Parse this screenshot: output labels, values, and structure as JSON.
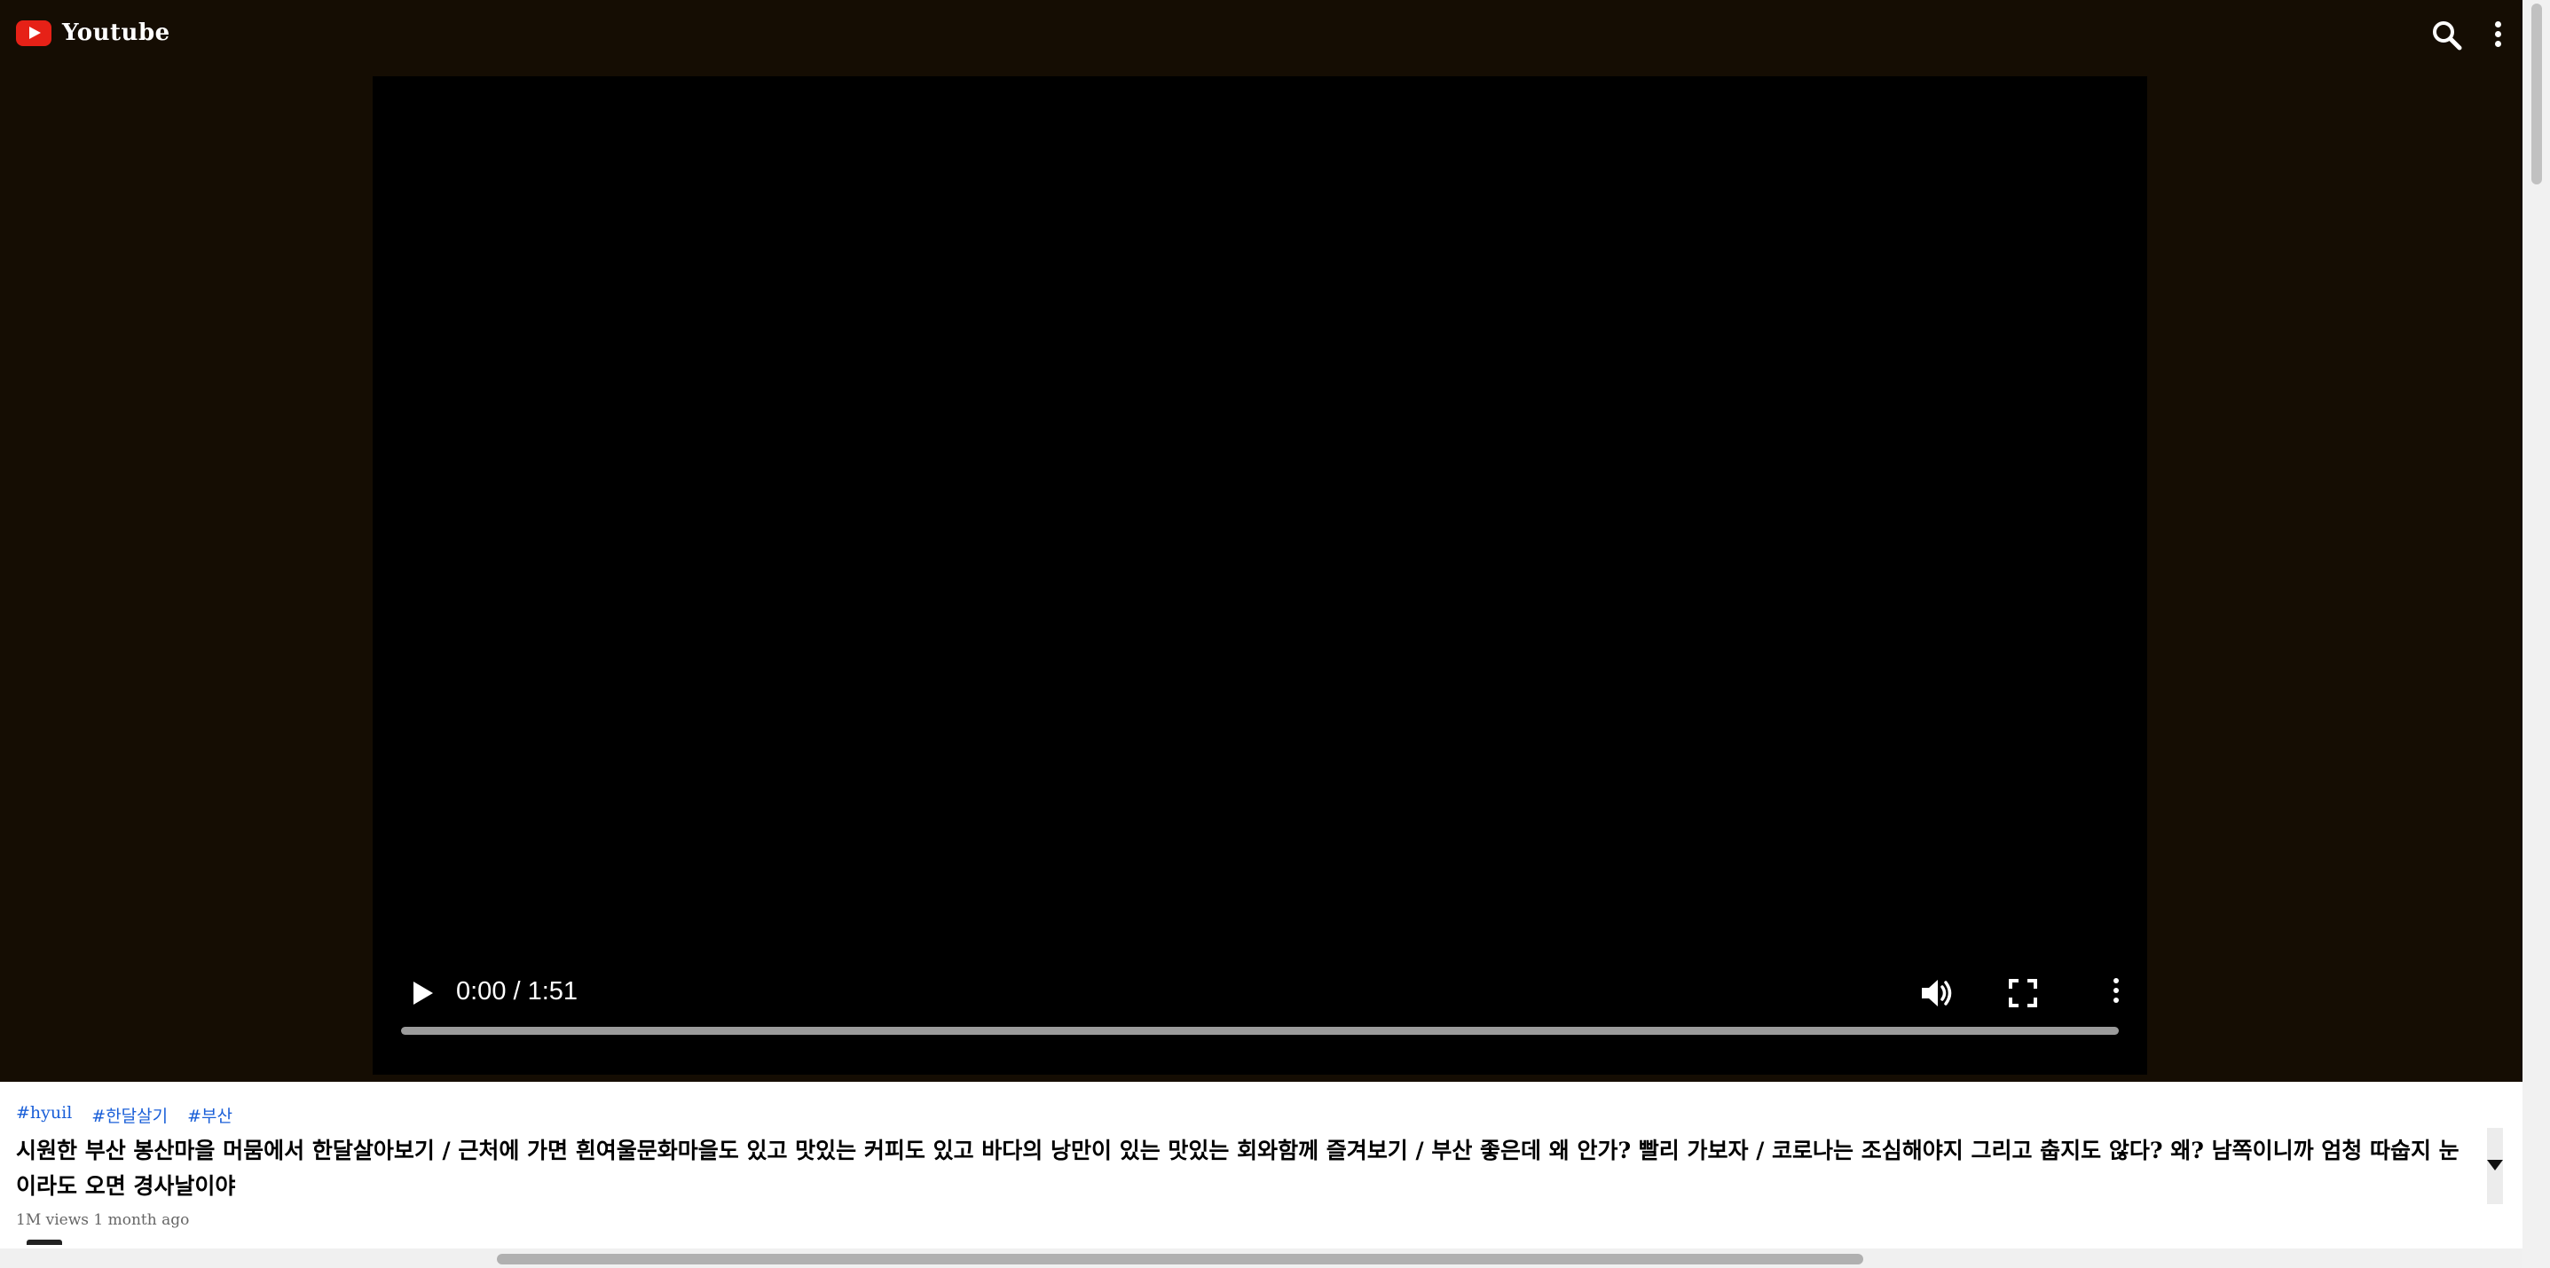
{
  "app": {
    "name": "Youtube"
  },
  "header": {
    "search_icon": "search-icon",
    "more_icon": "vertical-dots-icon"
  },
  "player": {
    "time_display": "0:00 / 1:51",
    "current_time": "0:00",
    "duration": "1:51",
    "progress_fraction": 0,
    "icons": [
      "play-icon",
      "volume-icon",
      "fullscreen-icon",
      "more-options-icon"
    ]
  },
  "video": {
    "tags": [
      "#hyuil",
      "#한달살기",
      "#부산"
    ],
    "title": "시원한 부산 봉산마을 머뭄에서 한달살아보기 / 근처에 가면 흰여울문화마을도 있고 맛있는 커피도 있고 바다의 낭만이 있는 맛있는 회와함께 즐겨보기 / 부산 좋은데 왜 안가? 빨리 가보자 / 코로나는 조심해야지 그리고 춥지도 않다? 왜? 남쪽이니까 엄청 따숩지 눈이라도 오면 경사날이야",
    "meta": "1M views 1 month ago"
  },
  "colors": {
    "page_bg": "#150d03",
    "player_bg": "#000000",
    "brand_red": "#e62117",
    "tag_blue": "#1a5fd8"
  }
}
